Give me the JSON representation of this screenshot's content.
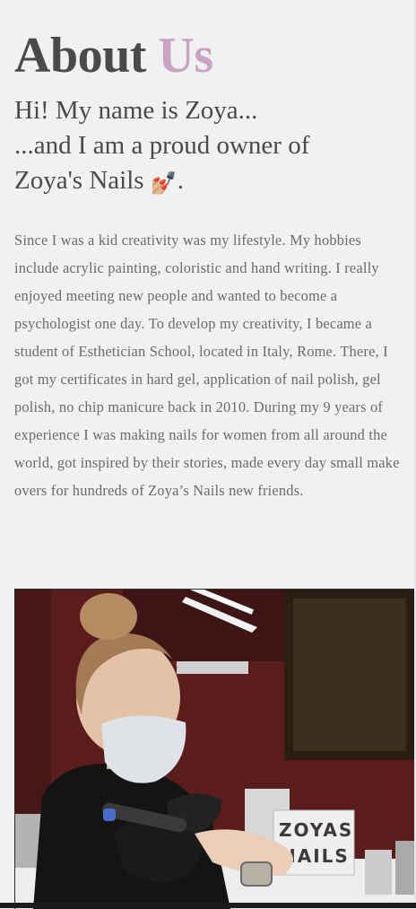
{
  "heading": {
    "part1": "About",
    "part2": "Us"
  },
  "intro": {
    "line1": "Hi! My name is Zoya...",
    "line2": "...and I am a proud owner of",
    "line3_text": "Zoya's Nails ",
    "line3_icon": "nail-polish-icon",
    "line3_end": "."
  },
  "bio": "Since I was a kid creativity was my lifestyle. My hobbies include acrylic painting, coloristic and hand writing. I really enjoyed meeting new people and wanted to become a psychologist one day. To develop my creativity, I became a student of Esthetician School, located in Italy, Rome. There, I got my certificates in hard gel, application of nail polish, gel polish, no chip manicure back in 2010. During my 9 years of experience I was making nails for women from all around the world, got inspired by their stories, made every day small make overs for hundreds of Zoya’s Nails new friends.",
  "photo": {
    "sign_line1": "ZOYAS",
    "sign_line2": "NAILS"
  },
  "colors": {
    "text": "#4a4a4a",
    "accent": "#caa3c4",
    "body_text": "#6b6b6b",
    "background": "#f1f1f1"
  }
}
